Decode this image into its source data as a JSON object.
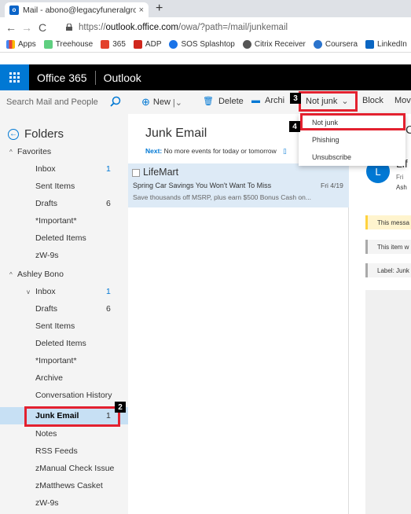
{
  "browser": {
    "tab_title": "Mail - abono@legacyfuneralgrou",
    "tab_close": "×",
    "new_tab": "+",
    "url_scheme": "https://",
    "url_host": "outlook.office.com",
    "url_path": "/owa/?path=/mail/junkemail",
    "bookmarks": [
      "Apps",
      "Treehouse",
      "365",
      "ADP",
      "SOS Splashtop",
      "Citrix Receiver",
      "Coursera",
      "LinkedIn"
    ]
  },
  "header": {
    "brand": "Office 365",
    "app": "Outlook"
  },
  "commandbar": {
    "search_placeholder": "Search Mail and People",
    "new_label": "New",
    "delete_label": "Delete",
    "archive_label": "Archi",
    "notjunk_label": "Not junk",
    "block_label": "Block",
    "move_label": "Mov"
  },
  "dropdown": {
    "items": [
      "Not junk",
      "Phishing",
      "Unsubscribe"
    ]
  },
  "folders": {
    "title": "Folders",
    "favorites_label": "Favorites",
    "favorites": [
      {
        "label": "Inbox",
        "count": "1"
      },
      {
        "label": "Sent Items",
        "count": ""
      },
      {
        "label": "Drafts",
        "count": "6"
      },
      {
        "label": "*Important*",
        "count": ""
      },
      {
        "label": "Deleted Items",
        "count": ""
      },
      {
        "label": "zW-9s",
        "count": ""
      }
    ],
    "account_label": "Ashley Bono",
    "inbox_label": "Inbox",
    "inbox_count": "1",
    "account_folders": [
      {
        "label": "Drafts",
        "count": "6"
      },
      {
        "label": "Sent Items",
        "count": ""
      },
      {
        "label": "Deleted Items",
        "count": ""
      },
      {
        "label": "*Important*",
        "count": ""
      },
      {
        "label": "Archive",
        "count": ""
      },
      {
        "label": "Conversation History",
        "count": ""
      },
      {
        "label": "Junk Email",
        "count": "1"
      },
      {
        "label": "Notes",
        "count": ""
      },
      {
        "label": "RSS Feeds",
        "count": ""
      },
      {
        "label": "zManual Check Issue",
        "count": ""
      },
      {
        "label": "zMatthews Casket",
        "count": ""
      },
      {
        "label": "zW-9s",
        "count": ""
      }
    ]
  },
  "list": {
    "title": "Junk Email",
    "next_label": "Next:",
    "next_text": "No more events for today or tomorrow",
    "message": {
      "sender": "LifeMart",
      "subject": "Spring Car Savings You Won't Want To Miss",
      "date": "Fri 4/19",
      "preview": "Save thousands off MSRP, plus earn $500 Bonus Cash on..."
    }
  },
  "reading": {
    "header_letter": "C",
    "avatar_letter": "L",
    "sender": "Lif",
    "date": "Fri",
    "to": "Ash",
    "banner1": "This messa",
    "banner2": "This item w",
    "banner3": "Label: Junk"
  },
  "annotations": {
    "step2": "2",
    "step3": "3",
    "step4": "4",
    "color": "#e3212f"
  }
}
